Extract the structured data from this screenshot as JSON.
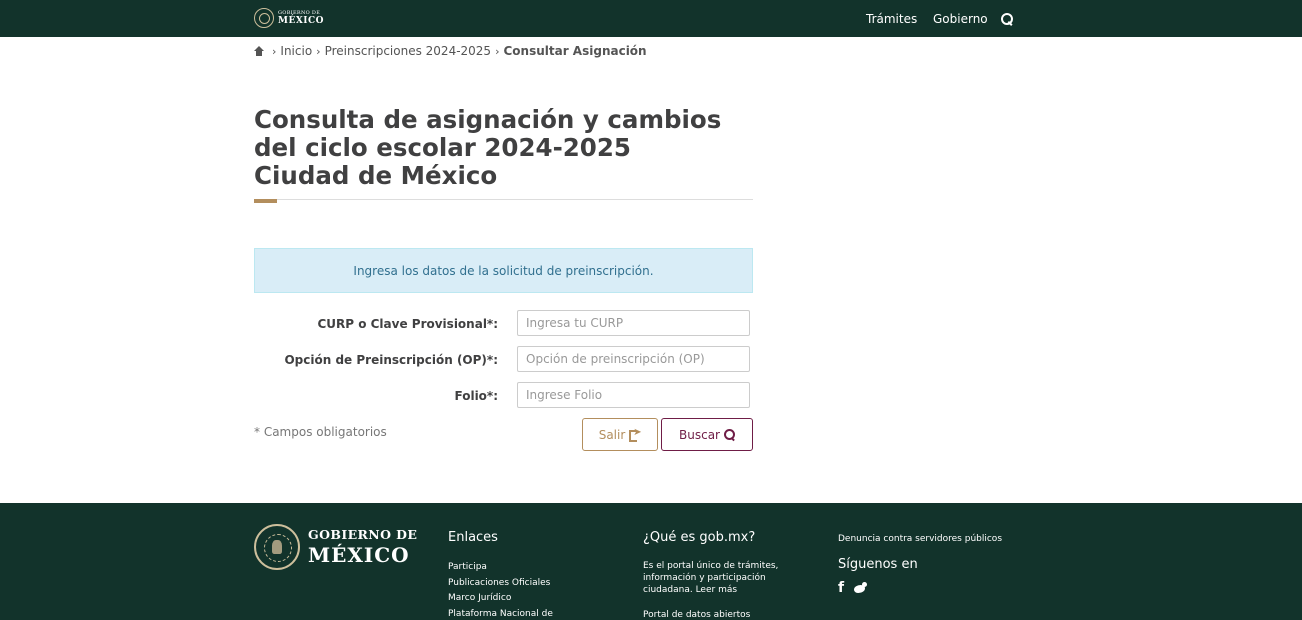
{
  "header": {
    "logo_line1": "GOBIERNO DE",
    "logo_line2": "MÉXICO",
    "nav": {
      "tramites": "Trámites",
      "gobierno": "Gobierno"
    },
    "search_icon": "search-icon"
  },
  "breadcrumb": {
    "home_icon": "home-icon",
    "items": [
      "Inicio",
      "Preinscripciones 2024-2025"
    ],
    "current": "Consultar Asignación"
  },
  "title": {
    "line1": "Consulta de asignación y cambios",
    "line2": "del ciclo escolar 2024-2025",
    "line3": "Ciudad de México"
  },
  "alert": {
    "text": "Ingresa los datos de la solicitud de preinscripción."
  },
  "form": {
    "curp": {
      "label": "CURP o Clave Provisional*:",
      "value": "",
      "placeholder": "Ingresa tu CURP"
    },
    "op": {
      "label": "Opción de Preinscripción (OP)*:",
      "value": "",
      "placeholder": "Opción de preinscripción (OP)"
    },
    "folio": {
      "label": "Folio*:",
      "value": "",
      "placeholder": "Ingrese Folio"
    },
    "required_note": "* Campos obligatorios",
    "buttons": {
      "salir": "Salir",
      "buscar": "Buscar"
    }
  },
  "footer": {
    "logo_line1": "GOBIERNO DE",
    "logo_line2": "MÉXICO",
    "enlaces": {
      "heading": "Enlaces",
      "links": [
        "Participa",
        "Publicaciones Oficiales",
        "Marco Jurídico",
        "Plataforma Nacional de"
      ]
    },
    "que_es": {
      "heading": "¿Qué es gob.mx?",
      "text": "Es el portal único de trámites, información y participación ciudadana.",
      "more": "Leer más",
      "portal": "Portal de datos abiertos"
    },
    "denuncia": "Denuncia contra servidores públicos",
    "siguenos": "Síguenos en",
    "social": {
      "facebook_glyph": "f",
      "facebook_icon": "facebook-icon",
      "twitter_icon": "twitter-icon"
    }
  },
  "colors": {
    "header_bg": "#12332b",
    "accent_gold": "#b38e5d",
    "accent_wine": "#6f1d46",
    "alert_bg": "#d9edf7",
    "alert_text": "#31708f"
  }
}
